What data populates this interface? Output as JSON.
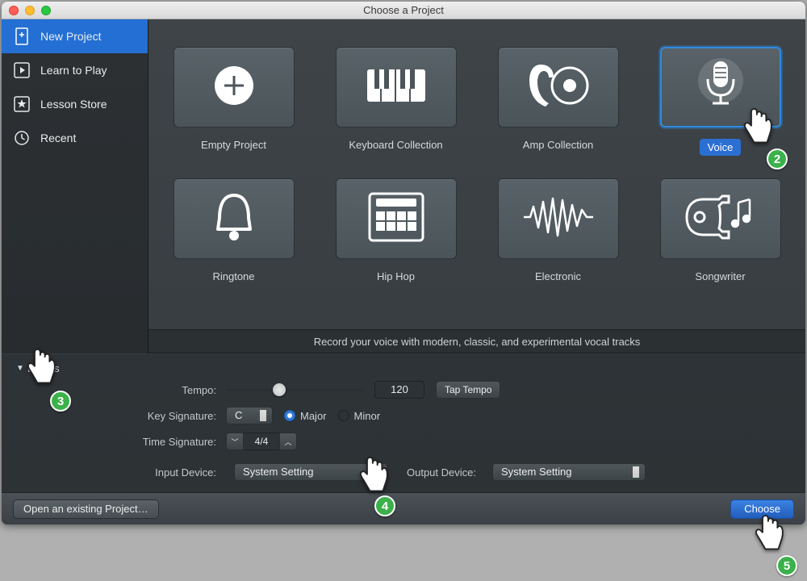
{
  "window": {
    "title": "Choose a Project"
  },
  "sidebar": {
    "items": [
      {
        "label": "New Project",
        "icon": "document-plus-icon"
      },
      {
        "label": "Learn to Play",
        "icon": "learn-play-icon"
      },
      {
        "label": "Lesson Store",
        "icon": "star-box-icon"
      },
      {
        "label": "Recent",
        "icon": "clock-icon"
      }
    ]
  },
  "templates": {
    "items": [
      {
        "label": "Empty Project"
      },
      {
        "label": "Keyboard Collection"
      },
      {
        "label": "Amp Collection"
      },
      {
        "label": "Voice"
      },
      {
        "label": "Ringtone"
      },
      {
        "label": "Hip Hop"
      },
      {
        "label": "Electronic"
      },
      {
        "label": "Songwriter"
      }
    ],
    "description": "Record your voice with modern, classic, and experimental vocal tracks"
  },
  "details": {
    "header": "Details",
    "tempo_label": "Tempo:",
    "tempo_value": "120",
    "tap_tempo": "Tap Tempo",
    "key_label": "Key Signature:",
    "key_value": "C",
    "major": "Major",
    "minor": "Minor",
    "time_label": "Time Signature:",
    "time_value": "4/4",
    "input_label": "Input Device:",
    "input_value": "System Setting",
    "output_label": "Output Device:",
    "output_value": "System Setting"
  },
  "footer": {
    "open_existing": "Open an existing Project…",
    "choose": "Choose"
  },
  "annotations": {
    "b2": "2",
    "b3": "3",
    "b4": "4",
    "b5": "5"
  }
}
